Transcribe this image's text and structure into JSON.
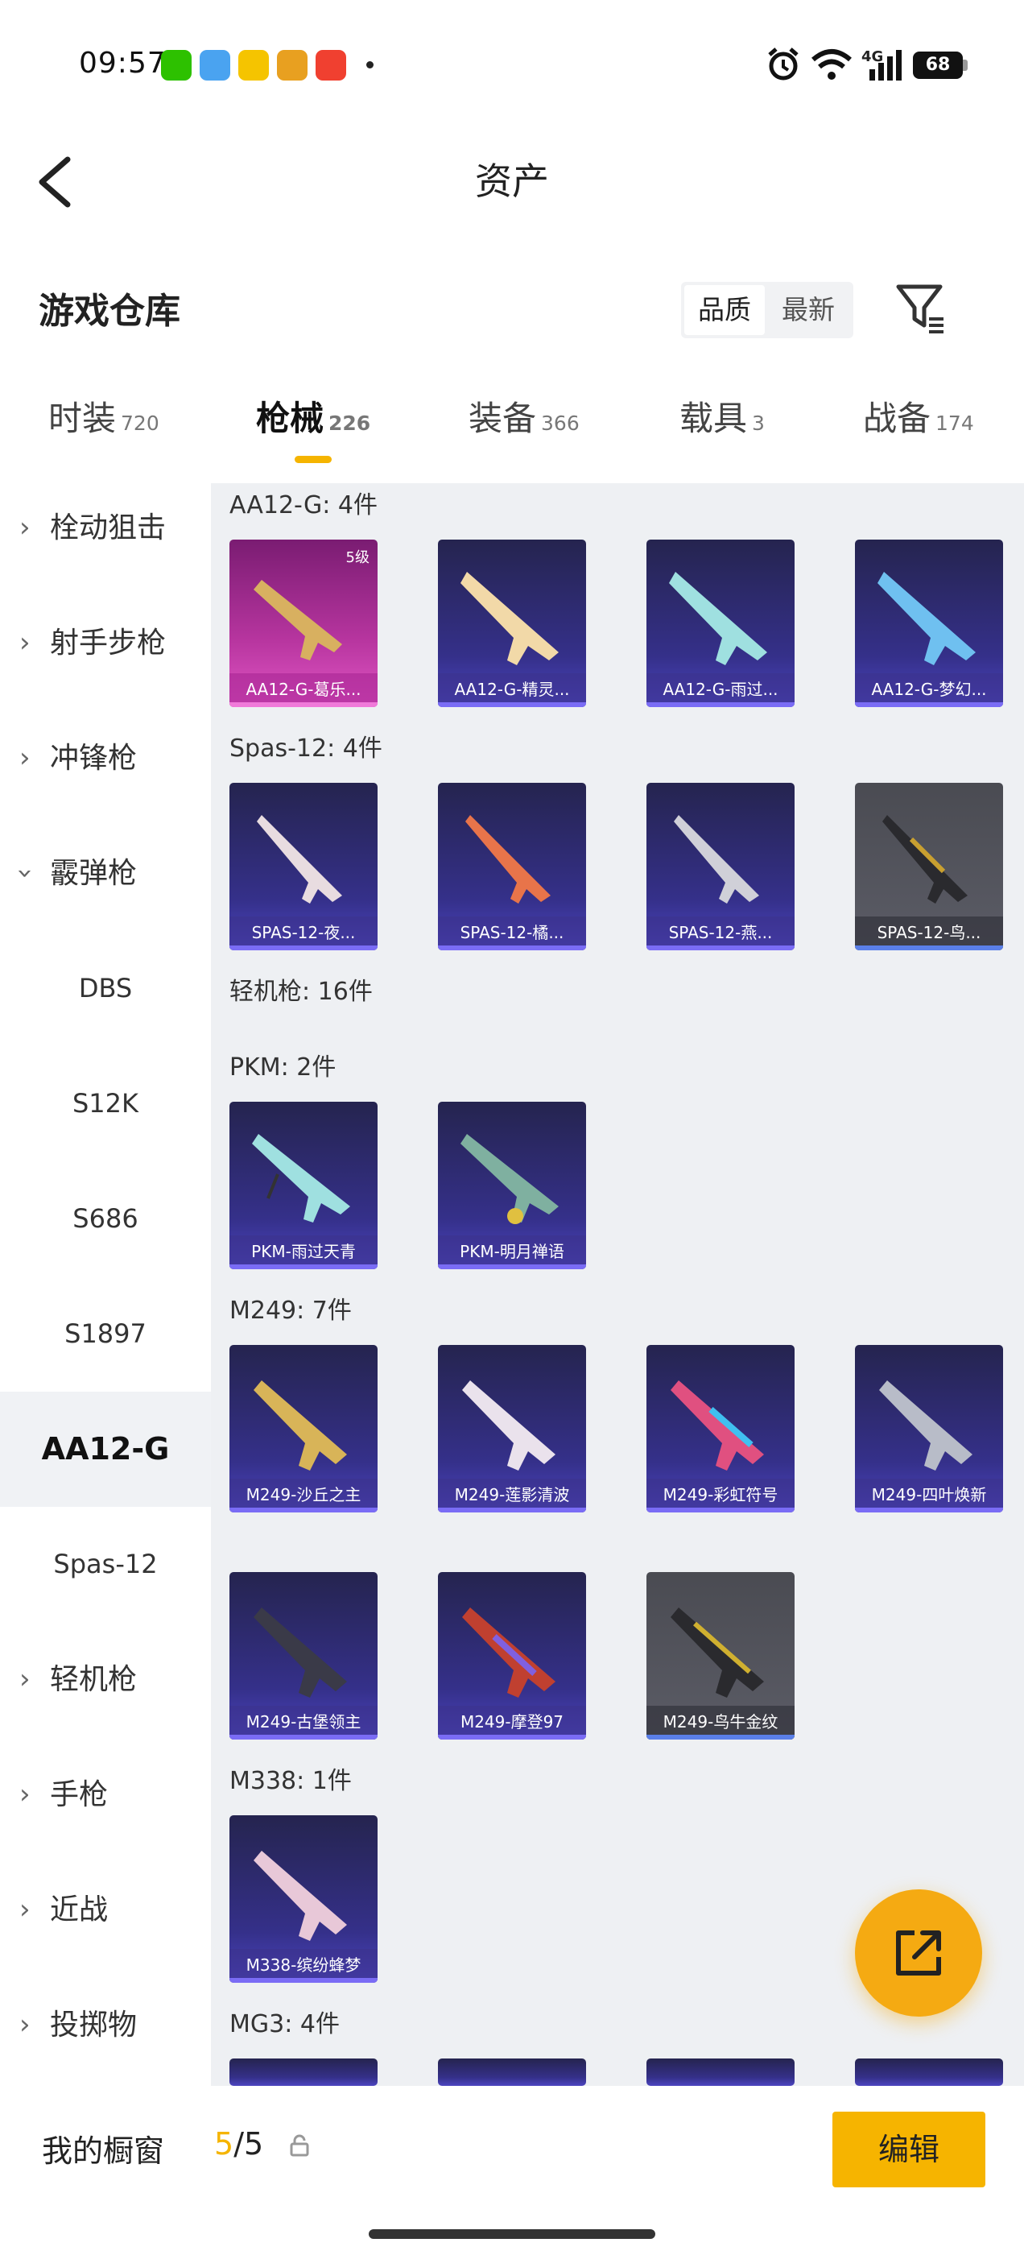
{
  "status_bar": {
    "time": "09:57",
    "signal": "4G",
    "battery": "68"
  },
  "header": {
    "title": "资产"
  },
  "warehouse": {
    "title": "游戏仓库",
    "sort_options": [
      "品质",
      "最新"
    ]
  },
  "tabs": [
    {
      "label": "时装",
      "count": "720"
    },
    {
      "label": "枪械",
      "count": "226"
    },
    {
      "label": "装备",
      "count": "366"
    },
    {
      "label": "载具",
      "count": "3"
    },
    {
      "label": "战备",
      "count": "174"
    }
  ],
  "sidebar": {
    "items": [
      {
        "label": "栓动狙击"
      },
      {
        "label": "射手步枪"
      },
      {
        "label": "冲锋枪"
      },
      {
        "label": "霰弹枪"
      },
      {
        "label": "DBS"
      },
      {
        "label": "S12K"
      },
      {
        "label": "S686"
      },
      {
        "label": "S1897"
      },
      {
        "label": "AA12-G"
      },
      {
        "label": "Spas-12"
      },
      {
        "label": "轻机枪"
      },
      {
        "label": "手枪"
      },
      {
        "label": "近战"
      },
      {
        "label": "投掷物"
      }
    ]
  },
  "groups": [
    {
      "title": "AA12-G: 4件",
      "cards": [
        {
          "label": "AA12-G-葛乐...",
          "tier": "5级"
        },
        {
          "label": "AA12-G-精灵..."
        },
        {
          "label": "AA12-G-雨过..."
        },
        {
          "label": "AA12-G-梦幻..."
        }
      ]
    },
    {
      "title": "Spas-12: 4件",
      "cards": [
        {
          "label": "SPAS-12-夜..."
        },
        {
          "label": "SPAS-12-橘..."
        },
        {
          "label": "SPAS-12-燕..."
        },
        {
          "label": "SPAS-12-鸟..."
        }
      ]
    },
    {
      "title": "轻机枪: 16件"
    },
    {
      "title": "PKM: 2件",
      "cards": [
        {
          "label": "PKM-雨过天青"
        },
        {
          "label": "PKM-明月禅语"
        }
      ]
    },
    {
      "title": "M249: 7件",
      "cards": [
        {
          "label": "M249-沙丘之主"
        },
        {
          "label": "M249-莲影清波"
        },
        {
          "label": "M249-彩虹符号"
        },
        {
          "label": "M249-四叶焕新"
        },
        {
          "label": "M249-古堡领主"
        },
        {
          "label": "M249-摩登97"
        },
        {
          "label": "M249-鸟牛金纹"
        }
      ]
    },
    {
      "title": "M338: 1件",
      "cards": [
        {
          "label": "M338-缤纷蜂梦"
        }
      ]
    },
    {
      "title": "MG3: 4件"
    }
  ],
  "bottom_bar": {
    "label": "我的橱窗",
    "count_current": "5",
    "count_total": "/5",
    "edit_label": "编辑"
  },
  "colors": {
    "accent": "#f5b400",
    "card_purple": "#35308a",
    "card_pink": "#b7359f",
    "card_gray": "#5b5c66"
  }
}
